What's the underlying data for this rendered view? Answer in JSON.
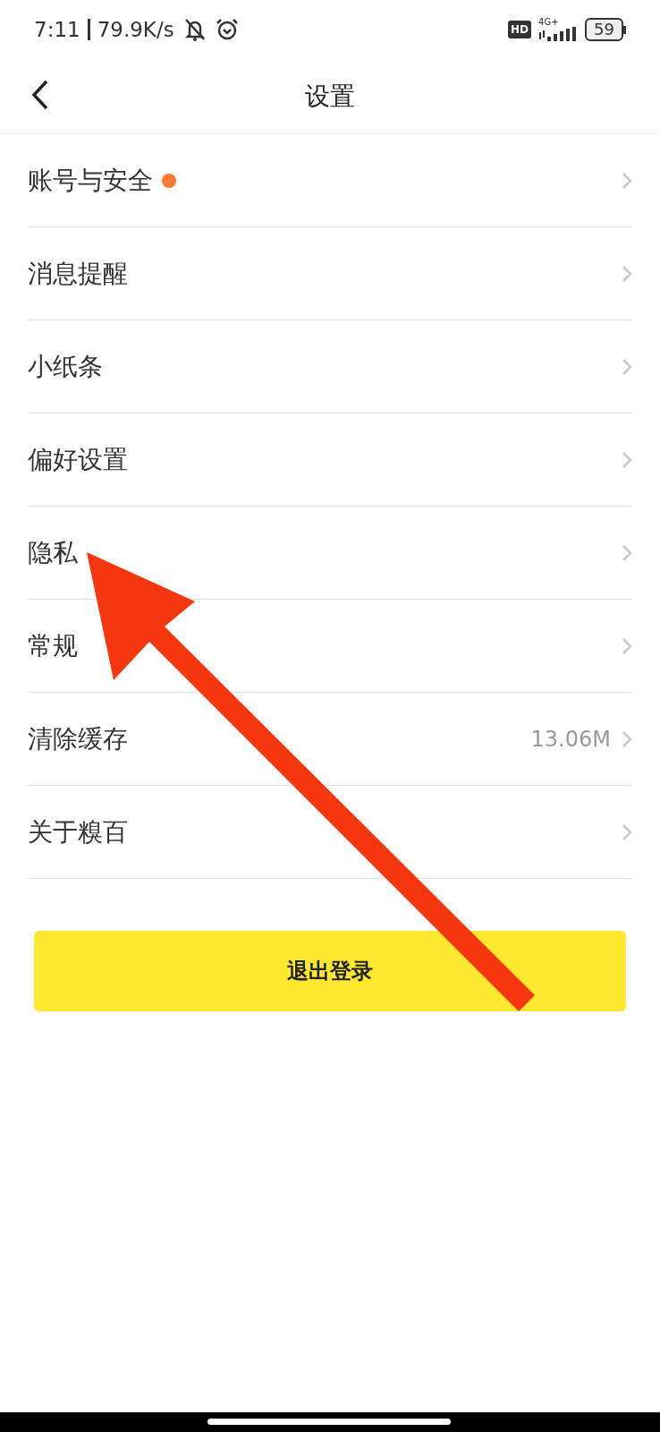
{
  "status_bar": {
    "time": "7:11",
    "network_speed": "79.9K/s",
    "hd_badge": "HD",
    "network_type": "4G+",
    "battery": "59"
  },
  "header": {
    "title": "设置"
  },
  "items": [
    {
      "label": "账号与安全",
      "dot": true
    },
    {
      "label": "消息提醒",
      "dot": false
    },
    {
      "label": "小纸条",
      "dot": false
    },
    {
      "label": "偏好设置",
      "dot": false
    },
    {
      "label": "隐私",
      "dot": false
    },
    {
      "label": "常规",
      "dot": false
    },
    {
      "label": "清除缓存",
      "dot": false,
      "value": "13.06M"
    },
    {
      "label": "关于糗百",
      "dot": false
    }
  ],
  "logout_button": "退出登录"
}
